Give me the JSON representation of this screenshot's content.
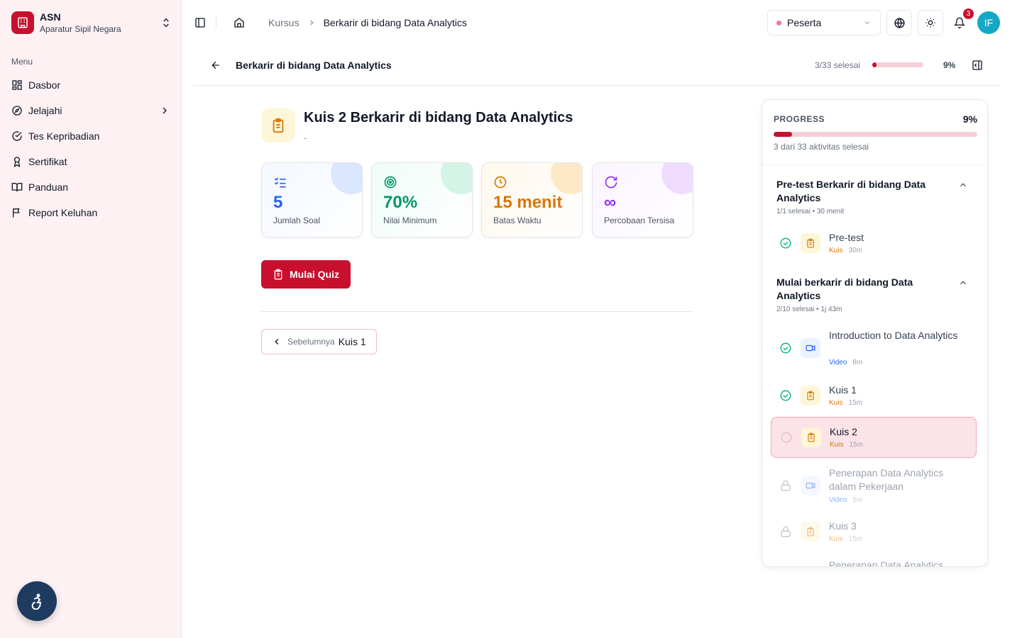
{
  "app": {
    "name": "ASN",
    "subtitle": "Aparatur Sipil Negara"
  },
  "sidebar": {
    "menu_label": "Menu",
    "items": [
      {
        "label": "Dasbor",
        "icon": "grid-icon"
      },
      {
        "label": "Jelajahi",
        "icon": "compass-icon",
        "has_submenu": true
      },
      {
        "label": "Tes Kepribadian",
        "icon": "check-circle-icon"
      },
      {
        "label": "Sertifikat",
        "icon": "award-icon"
      },
      {
        "label": "Panduan",
        "icon": "book-icon"
      },
      {
        "label": "Report Keluhan",
        "icon": "flag-icon"
      }
    ]
  },
  "header": {
    "breadcrumb": {
      "parent": "Kursus",
      "current": "Berkarir di bidang Data Analytics"
    },
    "role": {
      "selected": "Peserta"
    },
    "notifications": {
      "count": "3"
    },
    "user_initials": "IF"
  },
  "course": {
    "title": "Berkarir di bidang Data Analytics",
    "progress_text": "3/33 selesai",
    "progress_fraction": 0.09,
    "progress_pct": "9%"
  },
  "quiz": {
    "title": "Kuis 2 Berkarir di bidang Data Analytics",
    "subtitle": "-",
    "stats": [
      {
        "value": "5",
        "label": "Jumlah Soal",
        "color": "#2563eb",
        "icon": "list-check-icon"
      },
      {
        "value": "70%",
        "label": "Nilai Minimum",
        "color": "#059669",
        "icon": "target-icon"
      },
      {
        "value": "15 menit",
        "label": "Batas Waktu",
        "color": "#d97706",
        "icon": "clock-icon"
      },
      {
        "value": "∞",
        "label": "Percobaan Tersisa",
        "color": "#9333ea",
        "icon": "refresh-icon"
      }
    ],
    "start_label": "Mulai Quiz",
    "prev": {
      "small": "Sebelumnya",
      "name": "Kuis 1"
    }
  },
  "panel": {
    "label": "PROGRESS",
    "pct": "9%",
    "fraction": 0.09,
    "summary": "3 dari 33 aktivitas selesai",
    "sections": [
      {
        "title": "Pre-test Berkarir di bidang Data Analytics",
        "meta": "1/1 selesai  • 30 menit",
        "items": [
          {
            "name": "Pre-test",
            "type": "Kuis",
            "duration": "30m",
            "status": "done",
            "kind": "quiz"
          }
        ]
      },
      {
        "title": "Mulai berkarir di bidang Data Analytics",
        "meta": "2/10 selesai  • 1j 43m",
        "items": [
          {
            "name": "Introduction to Data Analytics",
            "type": "Video",
            "duration": "8m",
            "status": "done",
            "kind": "video"
          },
          {
            "name": "Kuis 1",
            "type": "Kuis",
            "duration": "15m",
            "status": "done",
            "kind": "quiz"
          },
          {
            "name": "Kuis 2",
            "type": "Kuis",
            "duration": "15m",
            "status": "active",
            "kind": "quiz"
          },
          {
            "name": "Penerapan Data Analytics dalam Pekerjaan",
            "type": "Video",
            "duration": "5m",
            "status": "locked",
            "kind": "video"
          },
          {
            "name": "Kuis 3",
            "type": "Kuis",
            "duration": "15m",
            "status": "locked",
            "kind": "quiz"
          },
          {
            "name": "Penerapan Data Analytics",
            "type": "",
            "duration": "",
            "status": "locked",
            "kind": "video"
          }
        ]
      }
    ]
  }
}
